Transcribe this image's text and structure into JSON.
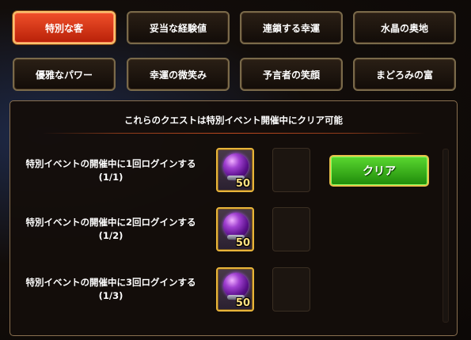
{
  "tabs": [
    {
      "label": "特別な客",
      "active": true
    },
    {
      "label": "妥当な経験値",
      "active": false
    },
    {
      "label": "連鎖する幸運",
      "active": false
    },
    {
      "label": "水晶の奥地",
      "active": false
    },
    {
      "label": "優雅なパワー",
      "active": false
    },
    {
      "label": "幸運の微笑み",
      "active": false
    },
    {
      "label": "予言者の笑顔",
      "active": false
    },
    {
      "label": "まどろみの富",
      "active": false
    }
  ],
  "panel": {
    "title": "これらのクエストは特別イベント開催中にクリア可能"
  },
  "quests": [
    {
      "line1": "特別イベントの開催中に1回ログインする",
      "progress": "(1/1)",
      "reward_icon": "purple-orb-icon",
      "reward_qty": "50"
    },
    {
      "line1": "特別イベントの開催中に2回ログインする",
      "progress": "(1/2)",
      "reward_icon": "purple-orb-icon",
      "reward_qty": "50"
    },
    {
      "line1": "特別イベントの開催中に3回ログインする",
      "progress": "(1/3)",
      "reward_icon": "purple-orb-icon",
      "reward_qty": "50"
    }
  ],
  "clear_button": {
    "label": "クリア"
  },
  "colors": {
    "active_tab": "#e0401a",
    "clear_button": "#3cb820",
    "border_gold": "#e8b43a"
  }
}
